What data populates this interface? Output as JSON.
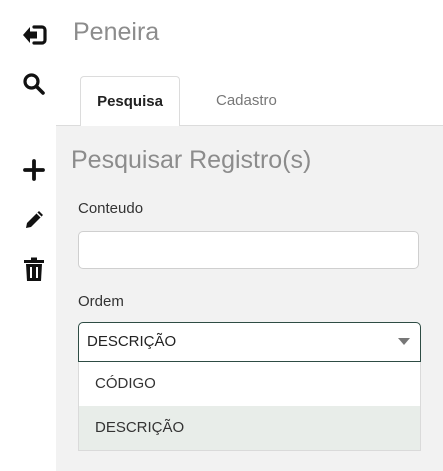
{
  "page": {
    "title": "Peneira"
  },
  "toolbar": {
    "icons": [
      "sign-in-icon",
      "search-icon",
      "plus-icon",
      "pencil-icon",
      "trash-icon"
    ]
  },
  "tabs": [
    {
      "label": "Pesquisa",
      "active": true
    },
    {
      "label": "Cadastro",
      "active": false
    }
  ],
  "form": {
    "title": "Pesquisar Registro(s)",
    "conteudo_label": "Conteudo",
    "conteudo_value": "",
    "ordem_label": "Ordem",
    "ordem_selected": "DESCRIÇÃO",
    "ordem_options": [
      "CÓDIGO",
      "DESCRIÇÃO"
    ]
  },
  "colors": {
    "panel_bg": "#f2f2f2",
    "select_border": "#2e4c44",
    "option_highlight": "#e8ede9",
    "muted_text": "#8c8c8c"
  }
}
